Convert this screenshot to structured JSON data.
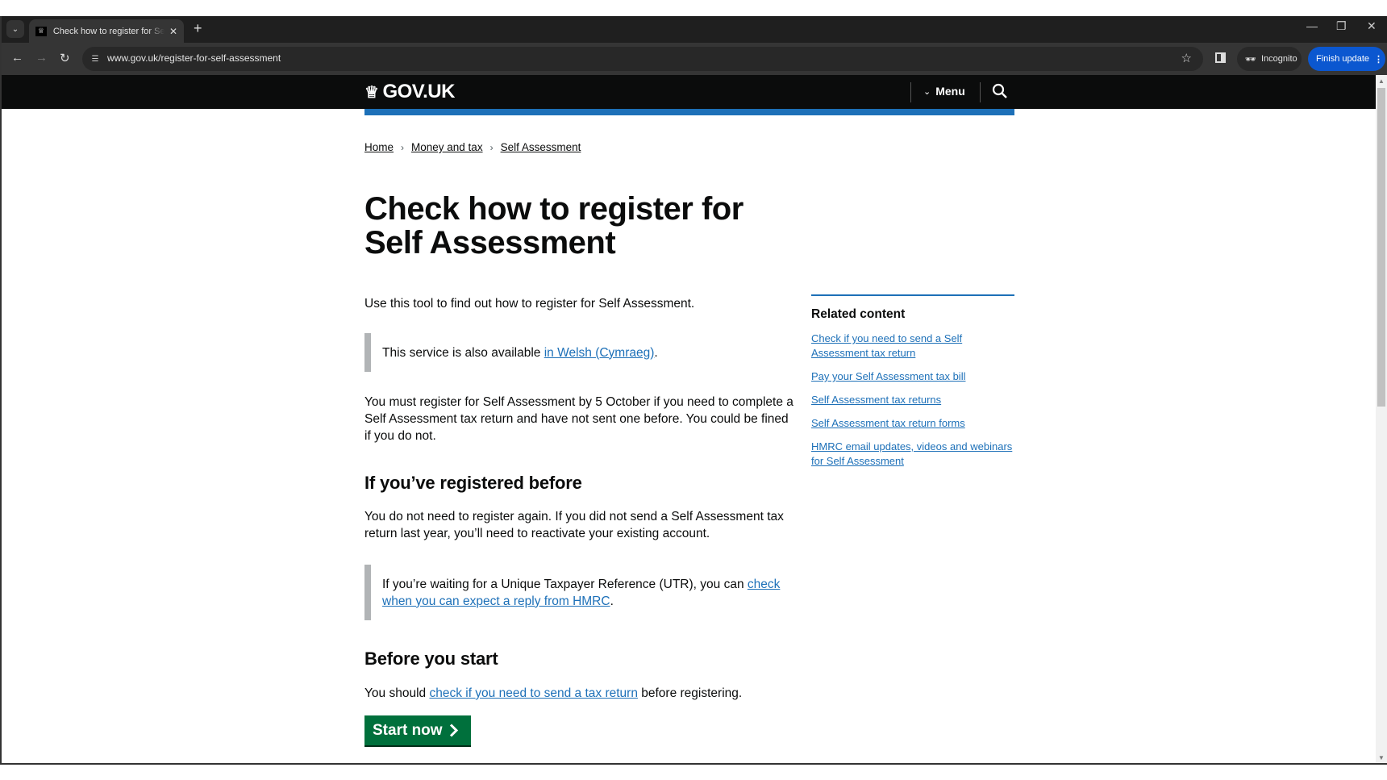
{
  "browser": {
    "tab_title": "Check how to register for Self Assessment",
    "url": "www.gov.uk/register-for-self-assessment",
    "incognito_label": "Incognito",
    "finish_update_label": "Finish update"
  },
  "header": {
    "logo_text": "GOV.UK",
    "menu_label": "Menu"
  },
  "breadcrumb": [
    "Home",
    "Money and tax",
    "Self Assessment"
  ],
  "page": {
    "title": "Check how to register for Self Assessment",
    "lead": "Use this tool to find out how to register for Self Assessment.",
    "welsh_inset": {
      "before": "This service is also available ",
      "link": "in Welsh (Cymraeg)",
      "after": "."
    },
    "deadline_text": "You must register for Self Assessment by 5 October if you need to complete a Self Assessment tax return and have not sent one before. You could be fined if you do not.",
    "registered_heading": "If you’ve registered before",
    "registered_text": "You do not need to register again. If you did not send a Self Assessment tax return last year, you’ll need to reactivate your existing account.",
    "utr_inset": {
      "before": "If you’re waiting for a Unique Taxpayer Reference (UTR), you can ",
      "link": "check when you can expect a reply from HMRC",
      "after": "."
    },
    "before_heading": "Before you start",
    "before_text": {
      "before": "You should ",
      "link": "check if you need to send a tax return",
      "after": " before registering."
    },
    "start_button": "Start now"
  },
  "related": {
    "heading": "Related content",
    "links": [
      "Check if you need to send a Self Assessment tax return",
      "Pay your Self Assessment tax bill",
      "Self Assessment tax returns",
      "Self Assessment tax return forms",
      "HMRC email updates, videos and webinars for Self Assessment"
    ]
  },
  "colors": {
    "gov_black": "#0b0c0c",
    "link_blue": "#1d70b8",
    "start_green": "#00703c",
    "inset_grey": "#b1b4b6"
  }
}
